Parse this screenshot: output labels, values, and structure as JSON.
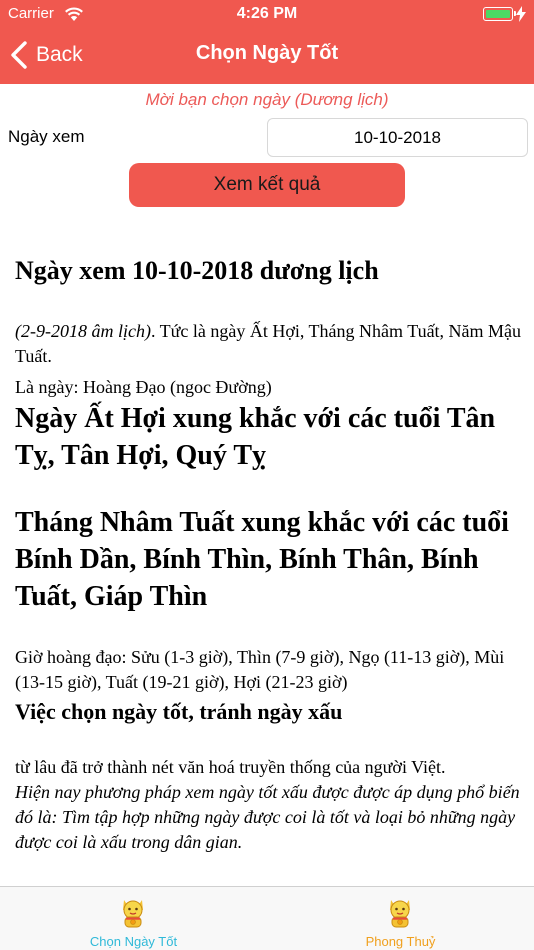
{
  "status": {
    "carrier": "Carrier",
    "time": "4:26 PM"
  },
  "nav": {
    "back_label": "Back",
    "title": "Chọn Ngày Tốt"
  },
  "form": {
    "hint": "Mời bạn chọn ngày (Dương lịch)",
    "date_label": "Ngày xem",
    "date_value": "10-10-2018",
    "submit_label": "Xem kết quả"
  },
  "article": {
    "heading": "Ngày xem 10-10-2018 dương lịch",
    "lunar_date": "(2-9-2018 âm lịch)",
    "lunar_desc": ". Tức là ngày Ất Hợi, Tháng Nhâm Tuất, Năm Mậu Tuất.",
    "day_type": "Là ngày: Hoàng Đạo (ngoc Đường)",
    "day_conflict": "Ngày Ất Hợi xung khắc với các tuổi Tân Tỵ, Tân Hợi, Quý Tỵ",
    "month_conflict": "Tháng Nhâm Tuất xung khắc với các tuổi Bính Dần, Bính Thìn, Bính Thân, Bính Tuất, Giáp Thìn",
    "good_hours": "Giờ hoàng đạo: Sửu (1-3 giờ), Thìn (7-9 giờ), Ngọ (11-13 giờ), Mùi (13-15 giờ), Tuất (19-21 giờ), Hợi (21-23 giờ)",
    "section_title": "Việc chọn ngày tốt, tránh ngày xấu",
    "section_p1": "từ lâu đã trở thành nét văn hoá truyền thống của người Việt.",
    "section_p2": "Hiện nay phương pháp xem ngày tốt xấu được được áp dụng phổ biến đó là: Tìm tập hợp những ngày được coi là tốt và loại bỏ những ngày được coi là xấu trong dân gian."
  },
  "tabs": [
    {
      "label": "Chọn Ngày Tốt",
      "color": "#2fb9d8",
      "icon": "lucky-cat-icon"
    },
    {
      "label": "Phong Thuỷ",
      "color": "#f0a01e",
      "icon": "lucky-cat-icon"
    }
  ],
  "colors": {
    "accent": "#f0584f",
    "hint": "#ec5a58",
    "battery": "#4cd964"
  }
}
